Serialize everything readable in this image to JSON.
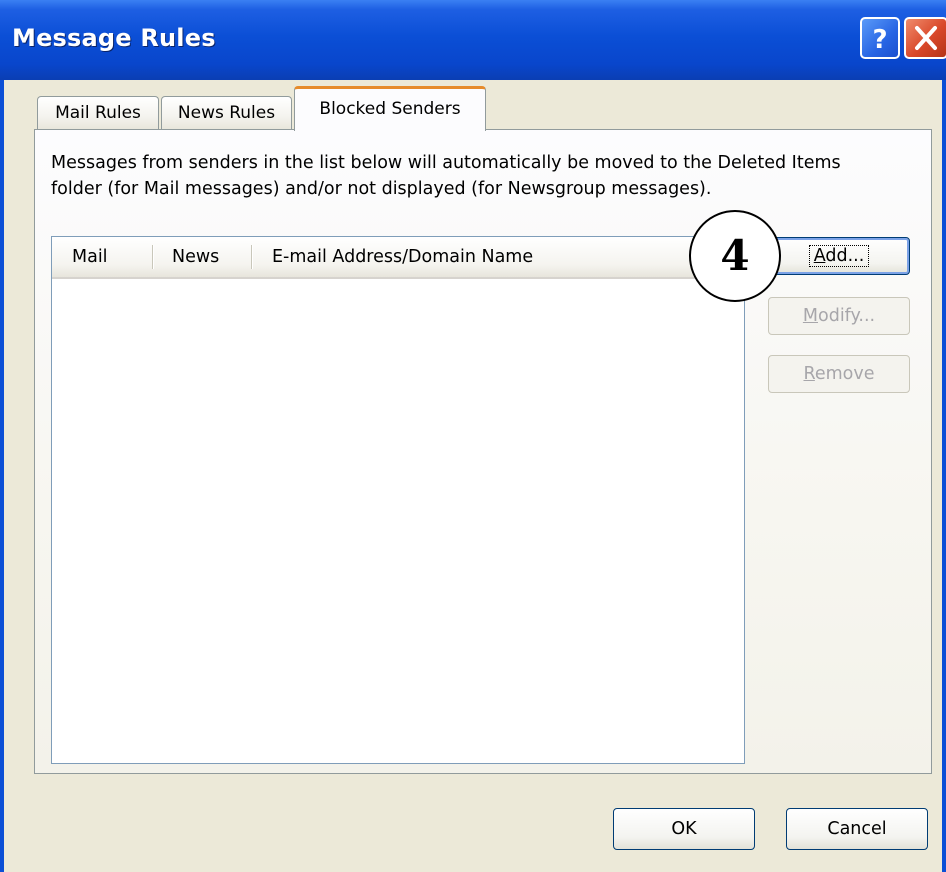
{
  "window": {
    "title": "Message Rules",
    "help_icon": "help-icon",
    "close_icon": "close-icon"
  },
  "tabs": [
    {
      "label": "Mail Rules",
      "selected": false
    },
    {
      "label": "News Rules",
      "selected": false
    },
    {
      "label": "Blocked Senders",
      "selected": true
    }
  ],
  "blocked_senders": {
    "description": "Messages from senders in the list below will automatically be moved to the Deleted Items\nfolder (for Mail messages) and/or not displayed (for Newsgroup messages).",
    "columns": [
      "Mail",
      "News",
      "E-mail Address/Domain Name"
    ],
    "rows": [],
    "buttons": {
      "add": {
        "label": "Add...",
        "access_key": "A",
        "enabled": true
      },
      "modify": {
        "label": "Modify...",
        "access_key": "M",
        "enabled": false
      },
      "remove": {
        "label": "Remove",
        "access_key": "R",
        "enabled": false
      }
    }
  },
  "footer": {
    "ok_label": "OK",
    "cancel_label": "Cancel"
  },
  "annotation": {
    "step_number": "4"
  },
  "colors": {
    "titlebar": "#0b4fd6",
    "active_tab_accent": "#e68b2c",
    "dialog_background": "#ece9d8",
    "close_button": "#d9482a"
  }
}
